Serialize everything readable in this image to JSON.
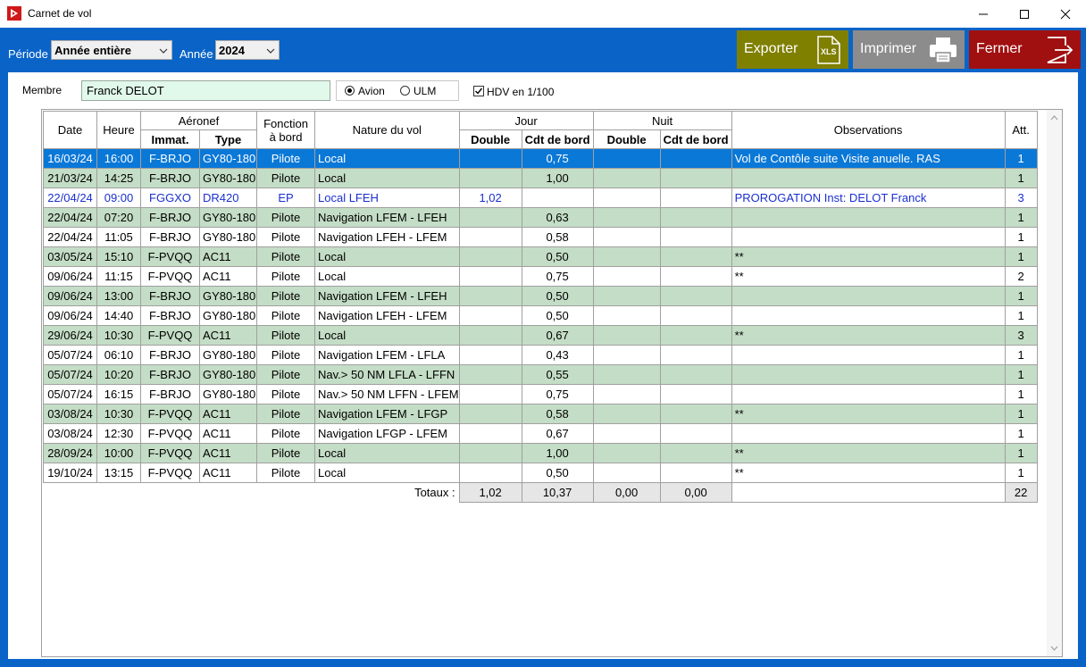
{
  "window": {
    "title": "Carnet de vol"
  },
  "toolbar": {
    "periode_label": "Période",
    "periode_value": "Année entière",
    "annee_label": "Année",
    "annee_value": "2024",
    "export_label": "Exporter",
    "print_label": "Imprimer",
    "close_label": "Fermer",
    "colors": {
      "export": "#7f7f00",
      "print": "#8c8c8c",
      "close": "#a01010"
    }
  },
  "filters": {
    "membre_label": "Membre",
    "membre_value": "Franck DELOT",
    "avion_label": "Avion",
    "ulm_label": "ULM",
    "avion_checked": true,
    "hdv_label": "HDV en 1/100",
    "hdv_checked": true
  },
  "grid": {
    "headers": {
      "date": "Date",
      "heure": "Heure",
      "aeronef": "Aéronef",
      "immat": "Immat.",
      "type": "Type",
      "fonction": "Fonction",
      "a_bord": "à bord",
      "nature": "Nature du vol",
      "jour": "Jour",
      "nuit": "Nuit",
      "double": "Double",
      "cdt": "Cdt de bord",
      "observations": "Observations",
      "att": "Att."
    },
    "rows": [
      {
        "date": "16/03/24",
        "heure": "16:00",
        "immat": "F-BRJO",
        "type": "GY80-180",
        "fonction": "Pilote",
        "nature": "Local",
        "jour_double": "",
        "jour_cdt": "0,75",
        "nuit_double": "",
        "nuit_cdt": "",
        "obs": "Vol de Contôle suite Visite anuelle. RAS",
        "att": "1",
        "style": "sel"
      },
      {
        "date": "21/03/24",
        "heure": "14:25",
        "immat": "F-BRJO",
        "type": "GY80-180",
        "fonction": "Pilote",
        "nature": "Local",
        "jour_double": "",
        "jour_cdt": "1,00",
        "nuit_double": "",
        "nuit_cdt": "",
        "obs": "",
        "att": "1",
        "style": "green"
      },
      {
        "date": "22/04/24",
        "heure": "09:00",
        "immat": "FGGXO",
        "type": "DR420",
        "fonction": "EP",
        "nature": "Local LFEH",
        "jour_double": "1,02",
        "jour_cdt": "",
        "nuit_double": "",
        "nuit_cdt": "",
        "obs": "PROROGATION  Inst: DELOT Franck",
        "att": "3",
        "style": "blue"
      },
      {
        "date": "22/04/24",
        "heure": "07:20",
        "immat": "F-BRJO",
        "type": "GY80-180",
        "fonction": "Pilote",
        "nature": "Navigation LFEM - LFEH",
        "jour_double": "",
        "jour_cdt": "0,63",
        "nuit_double": "",
        "nuit_cdt": "",
        "obs": "",
        "att": "1",
        "style": "green"
      },
      {
        "date": "22/04/24",
        "heure": "11:05",
        "immat": "F-BRJO",
        "type": "GY80-180",
        "fonction": "Pilote",
        "nature": "Navigation LFEH - LFEM",
        "jour_double": "",
        "jour_cdt": "0,58",
        "nuit_double": "",
        "nuit_cdt": "",
        "obs": "",
        "att": "1",
        "style": "white"
      },
      {
        "date": "03/05/24",
        "heure": "15:10",
        "immat": "F-PVQQ",
        "type": "AC11",
        "fonction": "Pilote",
        "nature": "Local",
        "jour_double": "",
        "jour_cdt": "0,50",
        "nuit_double": "",
        "nuit_cdt": "",
        "obs": "**",
        "att": "1",
        "style": "green"
      },
      {
        "date": "09/06/24",
        "heure": "11:15",
        "immat": "F-PVQQ",
        "type": "AC11",
        "fonction": "Pilote",
        "nature": "Local",
        "jour_double": "",
        "jour_cdt": "0,75",
        "nuit_double": "",
        "nuit_cdt": "",
        "obs": "**",
        "att": "2",
        "style": "white"
      },
      {
        "date": "09/06/24",
        "heure": "13:00",
        "immat": "F-BRJO",
        "type": "GY80-180",
        "fonction": "Pilote",
        "nature": "Navigation LFEM - LFEH",
        "jour_double": "",
        "jour_cdt": "0,50",
        "nuit_double": "",
        "nuit_cdt": "",
        "obs": "",
        "att": "1",
        "style": "green"
      },
      {
        "date": "09/06/24",
        "heure": "14:40",
        "immat": "F-BRJO",
        "type": "GY80-180",
        "fonction": "Pilote",
        "nature": "Navigation LFEH - LFEM",
        "jour_double": "",
        "jour_cdt": "0,50",
        "nuit_double": "",
        "nuit_cdt": "",
        "obs": "",
        "att": "1",
        "style": "white"
      },
      {
        "date": "29/06/24",
        "heure": "10:30",
        "immat": "F-PVQQ",
        "type": "AC11",
        "fonction": "Pilote",
        "nature": "Local",
        "jour_double": "",
        "jour_cdt": "0,67",
        "nuit_double": "",
        "nuit_cdt": "",
        "obs": "**",
        "att": "3",
        "style": "green"
      },
      {
        "date": "05/07/24",
        "heure": "06:10",
        "immat": "F-BRJO",
        "type": "GY80-180",
        "fonction": "Pilote",
        "nature": "Navigation LFEM - LFLA",
        "jour_double": "",
        "jour_cdt": "0,43",
        "nuit_double": "",
        "nuit_cdt": "",
        "obs": "",
        "att": "1",
        "style": "white"
      },
      {
        "date": "05/07/24",
        "heure": "10:20",
        "immat": "F-BRJO",
        "type": "GY80-180",
        "fonction": "Pilote",
        "nature": "Nav.> 50 NM LFLA - LFFN",
        "jour_double": "",
        "jour_cdt": "0,55",
        "nuit_double": "",
        "nuit_cdt": "",
        "obs": "",
        "att": "1",
        "style": "green"
      },
      {
        "date": "05/07/24",
        "heure": "16:15",
        "immat": "F-BRJO",
        "type": "GY80-180",
        "fonction": "Pilote",
        "nature": "Nav.> 50 NM LFFN - LFEM",
        "jour_double": "",
        "jour_cdt": "0,75",
        "nuit_double": "",
        "nuit_cdt": "",
        "obs": "",
        "att": "1",
        "style": "white"
      },
      {
        "date": "03/08/24",
        "heure": "10:30",
        "immat": "F-PVQQ",
        "type": "AC11",
        "fonction": "Pilote",
        "nature": "Navigation LFEM - LFGP",
        "jour_double": "",
        "jour_cdt": "0,58",
        "nuit_double": "",
        "nuit_cdt": "",
        "obs": "**",
        "att": "1",
        "style": "green"
      },
      {
        "date": "03/08/24",
        "heure": "12:30",
        "immat": "F-PVQQ",
        "type": "AC11",
        "fonction": "Pilote",
        "nature": "Navigation LFGP - LFEM",
        "jour_double": "",
        "jour_cdt": "0,67",
        "nuit_double": "",
        "nuit_cdt": "",
        "obs": "",
        "att": "1",
        "style": "white"
      },
      {
        "date": "28/09/24",
        "heure": "10:00",
        "immat": "F-PVQQ",
        "type": "AC11",
        "fonction": "Pilote",
        "nature": "Local",
        "jour_double": "",
        "jour_cdt": "1,00",
        "nuit_double": "",
        "nuit_cdt": "",
        "obs": "**",
        "att": "1",
        "style": "green"
      },
      {
        "date": "19/10/24",
        "heure": "13:15",
        "immat": "F-PVQQ",
        "type": "AC11",
        "fonction": "Pilote",
        "nature": "Local",
        "jour_double": "",
        "jour_cdt": "0,50",
        "nuit_double": "",
        "nuit_cdt": "",
        "obs": "**",
        "att": "1",
        "style": "white"
      }
    ],
    "totals": {
      "label": "Totaux :",
      "jour_double": "1,02",
      "jour_cdt": "10,37",
      "nuit_double": "0,00",
      "nuit_cdt": "0,00",
      "obs": "",
      "att": "22"
    }
  }
}
